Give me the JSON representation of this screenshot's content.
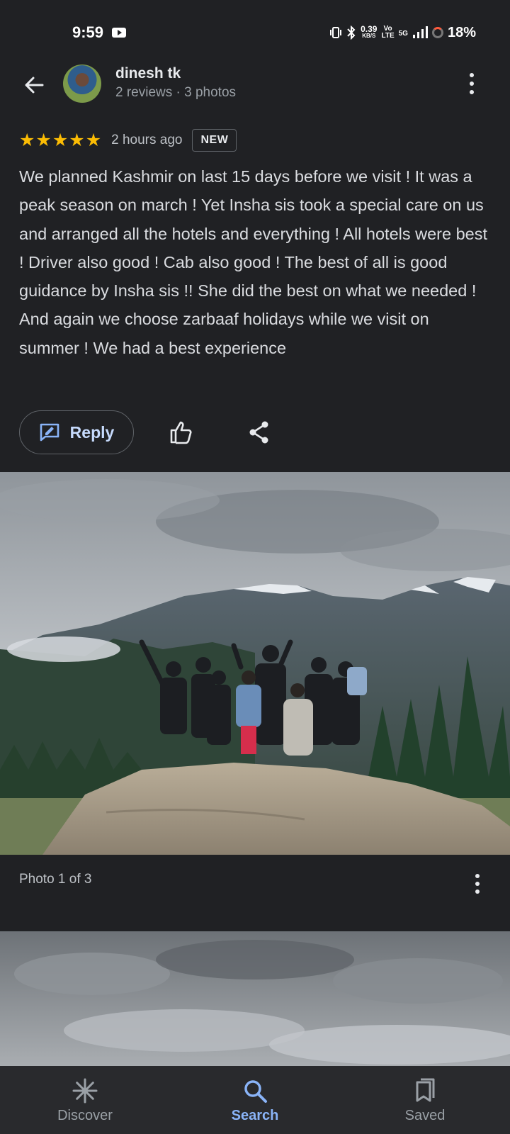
{
  "status_bar": {
    "time": "9:59",
    "net_speed_value": "0.39",
    "net_speed_unit": "KB/S",
    "volte_top": "Vo",
    "volte_bottom": "LTE",
    "network": "5G",
    "battery": "18%"
  },
  "review": {
    "reviewer_name": "dinesh tk",
    "reviewer_meta": "2 reviews · 3 photos",
    "rating": 5,
    "time_ago": "2 hours ago",
    "badge": "NEW",
    "text": "We planned Kashmir on last 15 days before we visit ! It was a peak season on march ! Yet Insha sis took a special care on us and arranged all the hotels and everything ! All hotels were best ! Driver also good ! Cab also good ! The best of all is good guidance by Insha sis !! She did the best on what we needed ! And again we choose zarbaaf holidays while we visit on summer ! We had a best experience"
  },
  "actions": {
    "reply_label": "Reply"
  },
  "photos": {
    "caption": "Photo 1 of 3"
  },
  "bottom_nav": {
    "items": [
      {
        "label": "Discover",
        "icon": "discover-icon",
        "active": false
      },
      {
        "label": "Search",
        "icon": "search-icon",
        "active": true
      },
      {
        "label": "Saved",
        "icon": "saved-icon",
        "active": false
      }
    ]
  },
  "colors": {
    "background": "#202124",
    "star": "#fbbc04",
    "accent": "#8ab4f8"
  },
  "icons": {
    "back": "back-arrow-icon",
    "more": "more-vert-icon",
    "reply": "reply-edit-icon",
    "like": "thumb-up-icon",
    "share": "share-icon"
  }
}
